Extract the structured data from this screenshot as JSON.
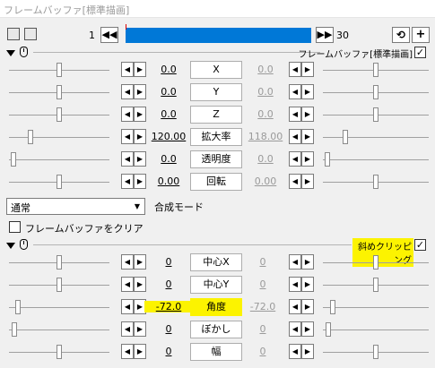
{
  "window": {
    "title": "フレームバッファ[標準描画]"
  },
  "toolbar": {
    "frame_start": "1",
    "frame_end": "30",
    "prev_label": "◀◀",
    "next_label": "▶▶",
    "icon_left_1": "camera-icon",
    "icon_left_2": "settings-icon",
    "icon_right_1": "loop-icon",
    "icon_right_2": "add-icon",
    "add_label": "+",
    "loop_label": "⟲"
  },
  "section1": {
    "name": "フレームバッファ[標準描画]",
    "checked": "✓",
    "rows": [
      {
        "label": "X",
        "left_value": "0.0",
        "right_value": "0.0",
        "left_fraction": 0.5,
        "right_fraction": 0.5
      },
      {
        "label": "Y",
        "left_value": "0.0",
        "right_value": "0.0",
        "left_fraction": 0.5,
        "right_fraction": 0.5
      },
      {
        "label": "Z",
        "left_value": "0.0",
        "right_value": "0.0",
        "left_fraction": 0.5,
        "right_fraction": 0.5
      },
      {
        "label": "拡大率",
        "left_value": "120.00",
        "right_value": "118.00",
        "left_fraction": 0.2,
        "right_fraction": 0.2
      },
      {
        "label": "透明度",
        "left_value": "0.0",
        "right_value": "0.0",
        "left_fraction": 0.02,
        "right_fraction": 0.02
      },
      {
        "label": "回転",
        "left_value": "0.00",
        "right_value": "0.00",
        "left_fraction": 0.5,
        "right_fraction": 0.5
      }
    ],
    "blend_mode": {
      "value": "通常",
      "label": "合成モード"
    },
    "clear_checkbox_label": "フレームバッファをクリア"
  },
  "section2": {
    "name": "斜めクリッピング",
    "checked": "✓",
    "rows": [
      {
        "label": "中心X",
        "left_value": "0",
        "right_value": "0",
        "left_fraction": 0.5,
        "right_fraction": 0.5,
        "highlighted": false
      },
      {
        "label": "中心Y",
        "left_value": "0",
        "right_value": "0",
        "left_fraction": 0.5,
        "right_fraction": 0.5,
        "highlighted": false
      },
      {
        "label": "角度",
        "left_value": "-72.0",
        "right_value": "-72.0",
        "left_fraction": 0.07,
        "right_fraction": 0.07,
        "highlighted": true
      },
      {
        "label": "ぼかし",
        "left_value": "0",
        "right_value": "0",
        "left_fraction": 0.03,
        "right_fraction": 0.03,
        "highlighted": false
      },
      {
        "label": "幅",
        "left_value": "0",
        "right_value": "0",
        "left_fraction": 0.5,
        "right_fraction": 0.5,
        "highlighted": false
      }
    ]
  },
  "colors": {
    "accent": "#0078d7",
    "highlight": "#fcf300",
    "background": "#f0f0f0"
  }
}
